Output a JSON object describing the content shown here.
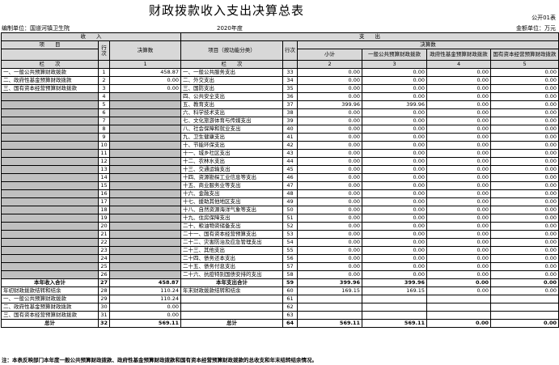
{
  "title": "财政拨款收入支出决算总表",
  "form_code": "公开01表",
  "unit_label": "编制单位：",
  "unit_name": "国道河镇卫生院",
  "year": "2020年度",
  "money_unit": "金额单位：万元",
  "header": {
    "income": "收　　入",
    "expense": "支　　出",
    "item": "项　　目",
    "row_no": "行次",
    "final_amount": "决算数",
    "item_func": "项目（按功能分类）",
    "final_group": "决算数",
    "subtotal": "小计",
    "col_gen": "一般公共预算财政拨款",
    "col_fund": "政府性基金预算财政拨款",
    "col_state": "国有资本经营预算财政拨款",
    "bar": "栏　　次",
    "bar_n1": "1",
    "bar_n2": "2",
    "bar_n3": "3",
    "bar_n4": "4",
    "bar_n5": "5"
  },
  "rows": [
    {
      "li": "一、一般公共预算财政拨款",
      "ln": "1",
      "la": "458.87",
      "ri": "一、一般公共服务支出",
      "rn": "33",
      "s": "0.00",
      "g": "0.00",
      "f": "0.00",
      "st": "0.00"
    },
    {
      "li": "二、政府性基金预算财政拨款",
      "ln": "2",
      "la": "0.00",
      "ri": "二、外交支出",
      "rn": "34",
      "s": "0.00",
      "g": "0.00",
      "f": "0.00",
      "st": "0.00"
    },
    {
      "li": "三、国有资本经营预算财政拨款",
      "ln": "3",
      "la": "0.00",
      "ri": "三、国防支出",
      "rn": "35",
      "s": "0.00",
      "g": "0.00",
      "f": "0.00",
      "st": "0.00"
    },
    {
      "li": "",
      "ln": "4",
      "la": "",
      "ri": "四、公共安全支出",
      "rn": "36",
      "s": "0.00",
      "g": "0.00",
      "f": "0.00",
      "st": "0.00"
    },
    {
      "li": "",
      "ln": "5",
      "la": "",
      "ri": "五、教育支出",
      "rn": "37",
      "s": "399.96",
      "g": "399.96",
      "f": "0.00",
      "st": "0.00"
    },
    {
      "li": "",
      "ln": "6",
      "la": "",
      "ri": "六、科学技术支出",
      "rn": "38",
      "s": "0.00",
      "g": "0.00",
      "f": "0.00",
      "st": "0.00"
    },
    {
      "li": "",
      "ln": "7",
      "la": "",
      "ri": "七、文化旅游体育与传媒支出",
      "rn": "39",
      "s": "0.00",
      "g": "0.00",
      "f": "0.00",
      "st": "0.00"
    },
    {
      "li": "",
      "ln": "8",
      "la": "",
      "ri": "八、社会保障和就业支出",
      "rn": "40",
      "s": "0.00",
      "g": "0.00",
      "f": "0.00",
      "st": "0.00"
    },
    {
      "li": "",
      "ln": "9",
      "la": "",
      "ri": "九、卫生健康支出",
      "rn": "41",
      "s": "0.00",
      "g": "0.00",
      "f": "0.00",
      "st": "0.00"
    },
    {
      "li": "",
      "ln": "10",
      "la": "",
      "ri": "十、节能环保支出",
      "rn": "42",
      "s": "0.00",
      "g": "0.00",
      "f": "0.00",
      "st": "0.00"
    },
    {
      "li": "",
      "ln": "11",
      "la": "",
      "ri": "十一、城乡社区支出",
      "rn": "43",
      "s": "0.00",
      "g": "0.00",
      "f": "0.00",
      "st": "0.00"
    },
    {
      "li": "",
      "ln": "12",
      "la": "",
      "ri": "十二、农林水支出",
      "rn": "44",
      "s": "0.00",
      "g": "0.00",
      "f": "0.00",
      "st": "0.00"
    },
    {
      "li": "",
      "ln": "13",
      "la": "",
      "ri": "十三、交通运输支出",
      "rn": "45",
      "s": "0.00",
      "g": "0.00",
      "f": "0.00",
      "st": "0.00"
    },
    {
      "li": "",
      "ln": "14",
      "la": "",
      "ri": "十四、资源勘探工业信息等支出",
      "rn": "46",
      "s": "0.00",
      "g": "0.00",
      "f": "0.00",
      "st": "0.00"
    },
    {
      "li": "",
      "ln": "15",
      "la": "",
      "ri": "十五、商业服务业等支出",
      "rn": "47",
      "s": "0.00",
      "g": "0.00",
      "f": "0.00",
      "st": "0.00"
    },
    {
      "li": "",
      "ln": "16",
      "la": "",
      "ri": "十六、金融支出",
      "rn": "48",
      "s": "0.00",
      "g": "0.00",
      "f": "0.00",
      "st": "0.00"
    },
    {
      "li": "",
      "ln": "17",
      "la": "",
      "ri": "十七、援助其他地区支出",
      "rn": "49",
      "s": "0.00",
      "g": "0.00",
      "f": "0.00",
      "st": "0.00"
    },
    {
      "li": "",
      "ln": "18",
      "la": "",
      "ri": "十八、自然资源海洋气象等支出",
      "rn": "50",
      "s": "0.00",
      "g": "0.00",
      "f": "0.00",
      "st": "0.00"
    },
    {
      "li": "",
      "ln": "19",
      "la": "",
      "ri": "十九、住房保障支出",
      "rn": "51",
      "s": "0.00",
      "g": "0.00",
      "f": "0.00",
      "st": "0.00"
    },
    {
      "li": "",
      "ln": "20",
      "la": "",
      "ri": "二十、粮油物资储备支出",
      "rn": "52",
      "s": "0.00",
      "g": "0.00",
      "f": "0.00",
      "st": "0.00"
    },
    {
      "li": "",
      "ln": "21",
      "la": "",
      "ri": "二十一、国有资本经营预算支出",
      "rn": "53",
      "s": "0.00",
      "g": "0.00",
      "f": "0.00",
      "st": "0.00"
    },
    {
      "li": "",
      "ln": "22",
      "la": "",
      "ri": "二十二、灾害防治及应急管理支出",
      "rn": "54",
      "s": "0.00",
      "g": "0.00",
      "f": "0.00",
      "st": "0.00"
    },
    {
      "li": "",
      "ln": "23",
      "la": "",
      "ri": "二十三、其他支出",
      "rn": "55",
      "s": "0.00",
      "g": "0.00",
      "f": "0.00",
      "st": "0.00"
    },
    {
      "li": "",
      "ln": "24",
      "la": "",
      "ri": "二十四、债务还本支出",
      "rn": "56",
      "s": "0.00",
      "g": "0.00",
      "f": "0.00",
      "st": "0.00"
    },
    {
      "li": "",
      "ln": "25",
      "la": "",
      "ri": "二十五、债务付息支出",
      "rn": "57",
      "s": "0.00",
      "g": "0.00",
      "f": "0.00",
      "st": "0.00"
    },
    {
      "li": "",
      "ln": "26",
      "la": "",
      "ri": "二十六、抗疫特别国债安排的支出",
      "rn": "58",
      "s": "0.00",
      "g": "0.00",
      "f": "0.00",
      "st": "0.00"
    },
    {
      "li": "本年收入合计",
      "ln": "27",
      "la": "458.87",
      "ri": "本年支出合计",
      "rn": "59",
      "s": "399.96",
      "g": "399.96",
      "f": "0.00",
      "st": "0.00",
      "bold": true
    },
    {
      "li": "年初财政拨款结转和结余",
      "ln": "28",
      "la": "110.24",
      "ri": "年末财政拨款结转和结余",
      "rn": "60",
      "s": "169.15",
      "g": "169.15",
      "f": "0.00",
      "st": "0.00"
    },
    {
      "li": "一、一般公共预算财政拨款",
      "ln": "29",
      "la": "110.24",
      "ri": "",
      "rn": "61",
      "s": "",
      "g": "",
      "f": "",
      "st": ""
    },
    {
      "li": "二、政府性基金预算财政拨款",
      "ln": "30",
      "la": "0.00",
      "ri": "",
      "rn": "62",
      "s": "",
      "g": "",
      "f": "",
      "st": ""
    },
    {
      "li": "三、国有资本经营预算财政拨款",
      "ln": "31",
      "la": "0.00",
      "ri": "",
      "rn": "63",
      "s": "",
      "g": "",
      "f": "",
      "st": ""
    },
    {
      "li": "总计",
      "ln": "32",
      "la": "569.11",
      "ri": "总计",
      "rn": "64",
      "s": "569.11",
      "g": "569.11",
      "f": "0.00",
      "st": "0.00",
      "bold": true
    }
  ],
  "note": "注：本表反映部门本年度一般公共预算财政拨款、政府性基金预算财政拨款和国有资本经营预算财政拨款的总收支和年末结转结余情况。"
}
